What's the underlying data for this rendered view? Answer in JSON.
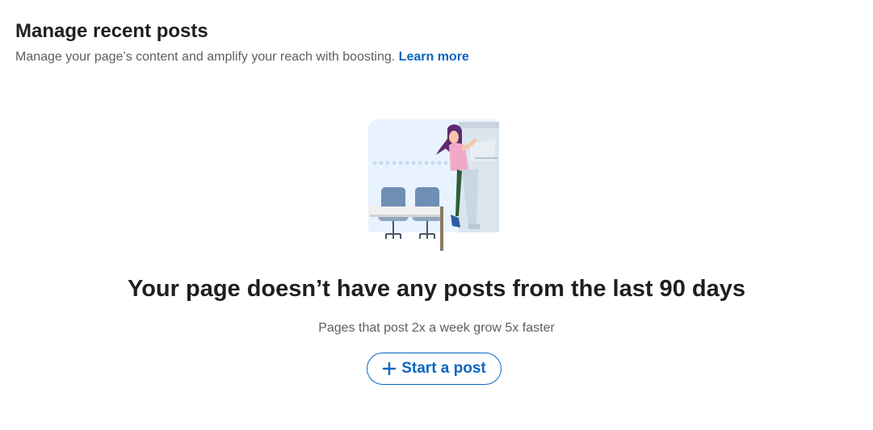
{
  "header": {
    "title": "Manage recent posts",
    "subtitle": "Manage your page’s content and amplify your reach with boosting.",
    "learn_more": "Learn more"
  },
  "empty_state": {
    "illustration": "person-at-desk-illustration",
    "title": "Your page doesn’t have any posts from the last 90 days",
    "subtitle": "Pages that post 2x a week grow 5x faster",
    "cta_label": "Start a post",
    "cta_icon": "plus-icon"
  },
  "colors": {
    "accent": "#0a66c2",
    "text_primary": "#1f1f1f",
    "text_secondary": "#5e5e5e"
  }
}
